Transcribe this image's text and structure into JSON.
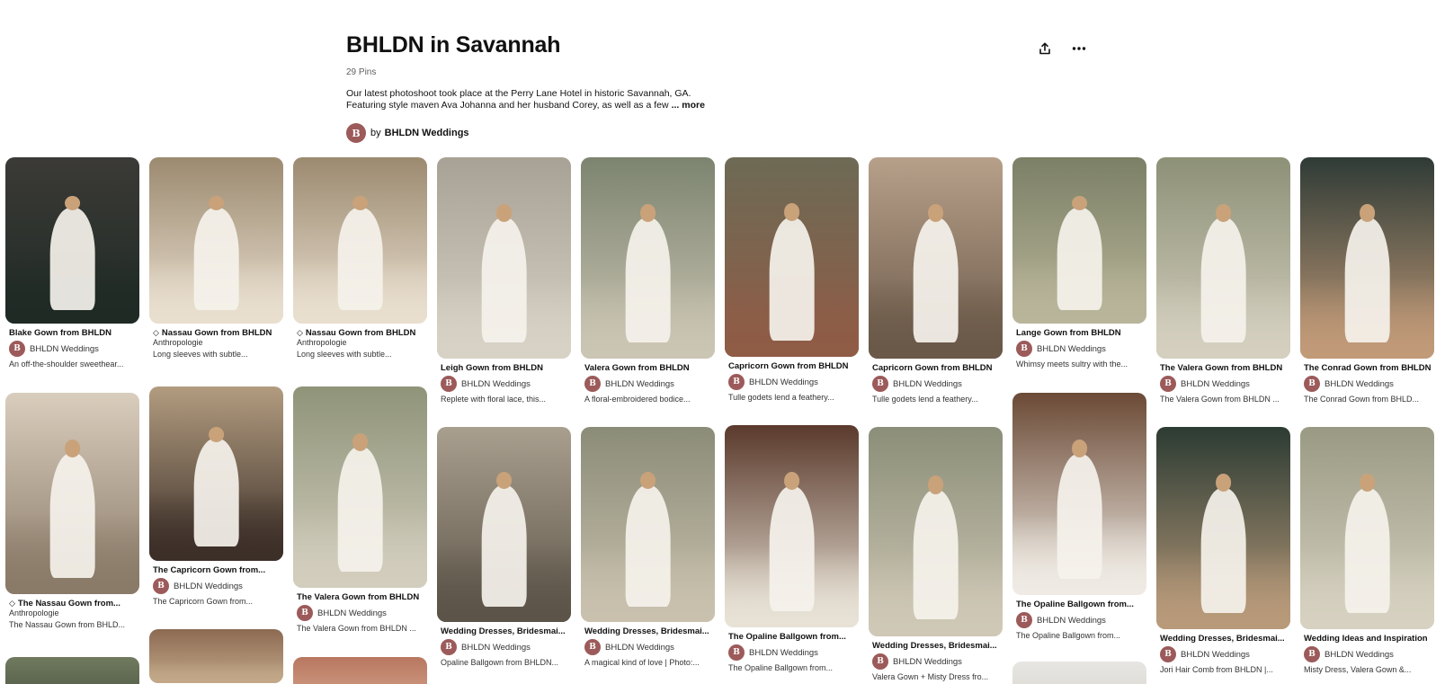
{
  "board": {
    "title": "BHLDN in Savannah",
    "pin_count": "29 Pins",
    "description_line1": "Our latest photoshoot took place at the Perry Lane Hotel in historic Savannah, GA.",
    "description_line2": "Featuring style maven Ava Johanna and her husband Corey, as well as a few",
    "more_label": "... more",
    "by_label": "by",
    "owner": "BHLDN Weddings",
    "avatar_letter": "B"
  },
  "actions": {
    "share_icon": "share-icon",
    "more_icon": "ellipsis-icon"
  },
  "columns": [
    [
      {
        "title": "Blake Gown from BHLDN",
        "author": "BHLDN Weddings",
        "desc": "An off-the-shoulder sweethear...",
        "colors": [
          "#3b3a36",
          "#1f2a25"
        ]
      },
      {
        "title": "The Nassau Gown from...",
        "tag": true,
        "source": "Anthropologie",
        "desc": "The Nassau Gown from BHLD...",
        "colors": [
          "#d9cdbd",
          "#8a7a68"
        ]
      },
      {
        "colors": [
          "#6f7a5e",
          "#4a5240"
        ]
      }
    ],
    [
      {
        "title": "Nassau Gown from BHLDN",
        "tag": true,
        "source": "Anthropologie",
        "desc": "Long sleeves with subtle...",
        "colors": [
          "#9c8a70",
          "#e9dfcf"
        ]
      },
      {
        "title": "The Capricorn Gown from...",
        "author": "BHLDN Weddings",
        "desc": "The Capricorn Gown from...",
        "colors": [
          "#b29c80",
          "#3c2f28"
        ]
      },
      {
        "colors": [
          "#8c6a52",
          "#c2a888"
        ]
      }
    ],
    [
      {
        "title": "Nassau Gown from BHLDN",
        "tag": true,
        "source": "Anthropologie",
        "desc": "Long sleeves with subtle...",
        "colors": [
          "#9c8a70",
          "#e9dfcf"
        ]
      },
      {
        "title": "The Valera Gown from BHLDN",
        "author": "BHLDN Weddings",
        "desc": "The Valera Gown from BHLDN ...",
        "colors": [
          "#8f9479",
          "#d2cdbd"
        ]
      },
      {
        "colors": [
          "#b87760",
          "#d9a890"
        ]
      }
    ],
    [
      {
        "title": "Leigh Gown from BHLDN",
        "author": "BHLDN Weddings",
        "desc": "Replete with floral lace, this...",
        "colors": [
          "#a8a296",
          "#d8d2c6"
        ]
      },
      {
        "title": "Wedding Dresses, Bridesmai...",
        "author": "BHLDN Weddings",
        "desc": "Opaline Ballgown from BHLDN...",
        "colors": [
          "#a99f8f",
          "#5c5448"
        ]
      }
    ],
    [
      {
        "title": "Valera Gown from BHLDN",
        "author": "BHLDN Weddings",
        "desc": "A floral-embroidered bodice...",
        "colors": [
          "#7c8470",
          "#cbc5b3"
        ]
      },
      {
        "title": "Wedding Dresses, Bridesmai...",
        "author": "BHLDN Weddings",
        "desc": "A magical kind of love | Photo:...",
        "colors": [
          "#8b8c78",
          "#c9c1ae"
        ]
      }
    ],
    [
      {
        "title": "Capricorn Gown from BHLDN",
        "author": "BHLDN Weddings",
        "desc": "Tulle godets lend a feathery...",
        "colors": [
          "#6d6a55",
          "#8f5c46"
        ]
      },
      {
        "title": "The Opaline Ballgown from...",
        "author": "BHLDN Weddings",
        "desc": "The Opaline Ballgown from...",
        "colors": [
          "#5a3a2c",
          "#e8e2d6"
        ]
      }
    ],
    [
      {
        "title": "Capricorn Gown from BHLDN",
        "author": "BHLDN Weddings",
        "desc": "Tulle godets lend a feathery...",
        "colors": [
          "#b7a08a",
          "#6a5848"
        ]
      },
      {
        "title": "Wedding Dresses, Bridesmai...",
        "author": "BHLDN Weddings",
        "desc": "Valera Gown + Misty Dress fro...",
        "colors": [
          "#8b8e78",
          "#cfc8b6"
        ]
      }
    ],
    [
      {
        "title": "Lange Gown from BHLDN",
        "author": "BHLDN Weddings",
        "desc": "Whimsy meets sultry with the...",
        "colors": [
          "#7b8066",
          "#b9b59a"
        ]
      },
      {
        "title": "The Opaline Ballgown from...",
        "author": "BHLDN Weddings",
        "desc": "The Opaline Ballgown from...",
        "colors": [
          "#6b4a36",
          "#efebe4"
        ]
      },
      {
        "colors": [
          "#e8e6e2",
          "#d6d3cd"
        ]
      }
    ],
    [
      {
        "title": "The Valera Gown from BHLDN",
        "author": "BHLDN Weddings",
        "desc": "The Valera Gown from BHLDN ...",
        "colors": [
          "#8d9177",
          "#d4cfbf"
        ]
      },
      {
        "title": "Wedding Dresses, Bridesmai...",
        "author": "BHLDN Weddings",
        "desc": "Jori Hair Comb from BHLDN |...",
        "colors": [
          "#2c3b33",
          "#b89a7a"
        ]
      }
    ],
    [
      {
        "title": "The Conrad Gown from BHLDN",
        "author": "BHLDN Weddings",
        "desc": "The Conrad Gown from BHLD...",
        "colors": [
          "#2f3b36",
          "#c19a78"
        ]
      },
      {
        "title": "Wedding Ideas and Inspiration",
        "author": "BHLDN Weddings",
        "desc": "Misty Dress, Valera Gown &...",
        "colors": [
          "#9a9a84",
          "#d6d1c0"
        ]
      }
    ]
  ]
}
